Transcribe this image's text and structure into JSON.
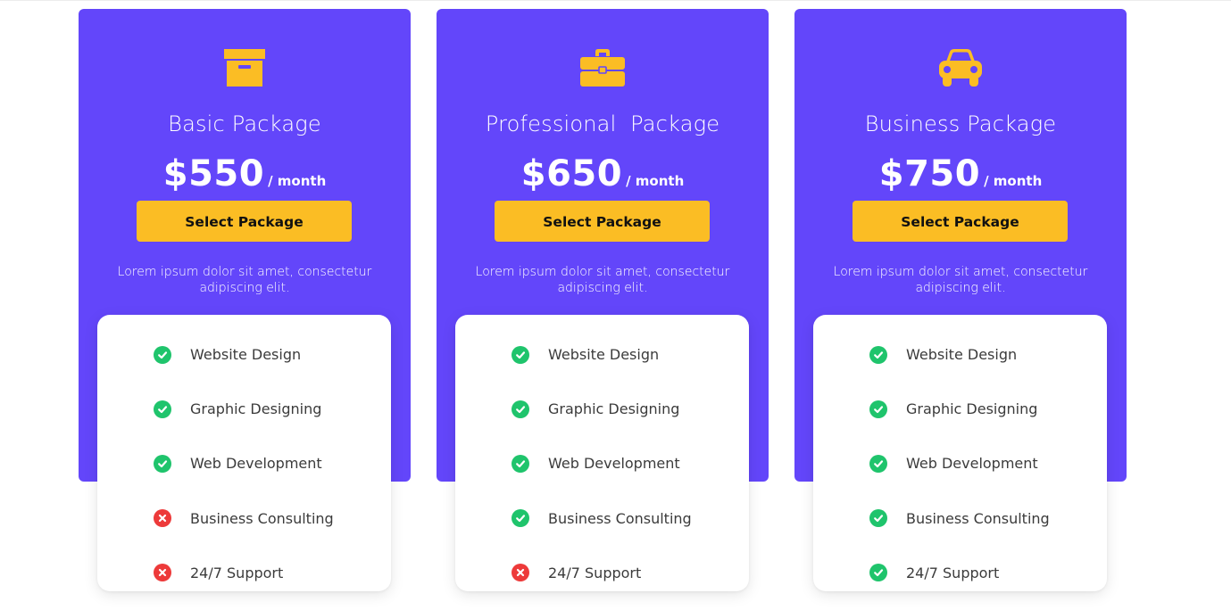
{
  "colors": {
    "card_background": "#6346fa",
    "button_background": "#fbbd24",
    "icon_color": "#fbbd24",
    "included": "#1fc46c",
    "excluded": "#ed3a3a"
  },
  "plans": [
    {
      "icon": "archive-box-icon",
      "title": "Basic Package",
      "price": "$550",
      "period": "/ month",
      "button_label": "Select Package",
      "description": "Lorem ipsum dolor sit amet, consectetur adipiscing elit.",
      "features": [
        {
          "label": "Website Design",
          "included": true,
          "icon": "check-icon"
        },
        {
          "label": "Graphic Designing",
          "included": true,
          "icon": "check-icon"
        },
        {
          "label": "Web Development",
          "included": true,
          "icon": "check-icon"
        },
        {
          "label": "Business Consulting",
          "included": false,
          "icon": "cross-icon"
        },
        {
          "label": "24/7 Support",
          "included": false,
          "icon": "cross-icon"
        }
      ]
    },
    {
      "icon": "briefcase-icon",
      "title": "Professional  Package",
      "price": "$650",
      "period": "/ month",
      "button_label": "Select Package",
      "description": "Lorem ipsum dolor sit amet, consectetur adipiscing elit.",
      "features": [
        {
          "label": "Website Design",
          "included": true,
          "icon": "check-icon"
        },
        {
          "label": "Graphic Designing",
          "included": true,
          "icon": "check-icon"
        },
        {
          "label": "Web Development",
          "included": true,
          "icon": "check-icon"
        },
        {
          "label": "Business Consulting",
          "included": true,
          "icon": "check-icon"
        },
        {
          "label": "24/7 Support",
          "included": false,
          "icon": "cross-icon"
        }
      ]
    },
    {
      "icon": "car-icon",
      "title": "Business Package",
      "price": "$750",
      "period": "/ month",
      "button_label": "Select Package",
      "description": "Lorem ipsum dolor sit amet, consectetur adipiscing elit.",
      "features": [
        {
          "label": "Website Design",
          "included": true,
          "icon": "check-icon"
        },
        {
          "label": "Graphic Designing",
          "included": true,
          "icon": "check-icon"
        },
        {
          "label": "Web Development",
          "included": true,
          "icon": "check-icon"
        },
        {
          "label": "Business Consulting",
          "included": true,
          "icon": "check-icon"
        },
        {
          "label": "24/7 Support",
          "included": true,
          "icon": "check-icon"
        }
      ]
    }
  ]
}
